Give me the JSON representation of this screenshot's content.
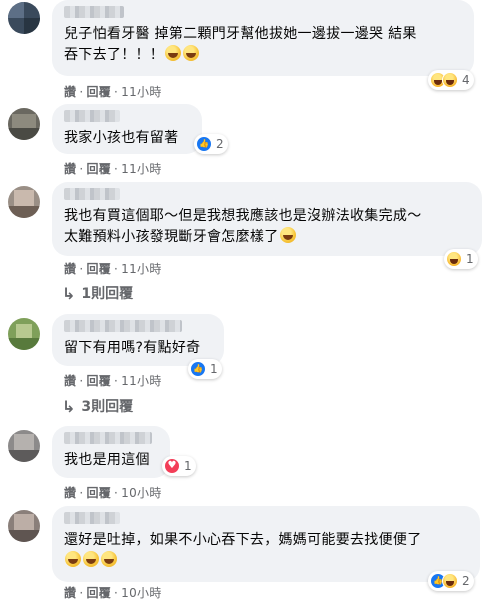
{
  "comments": [
    {
      "text": "兒子怕看牙醫 掉第二顆門牙幫他拔她一邊拔一邊哭 結果\n吞下去了！！！",
      "emoji_count": 2,
      "like_label": "讚",
      "reply_label": "回覆",
      "time": "11小時",
      "reactions": {
        "icons": [
          "haha-icon",
          "haha-icon"
        ],
        "count": "4"
      }
    },
    {
      "text": "我家小孩也有留著",
      "like_label": "讚",
      "reply_label": "回覆",
      "time": "11小時",
      "reactions": {
        "icons": [
          "like-icon"
        ],
        "count": "2"
      }
    },
    {
      "text": "我也有買這個耶～但是我想我應該也是沒辦法收集完成～\n太難預料小孩發現斷牙會怎麼樣了",
      "emoji_count": 1,
      "like_label": "讚",
      "reply_label": "回覆",
      "time": "11小時",
      "reactions": {
        "icons": [
          "haha-icon"
        ],
        "count": "1"
      },
      "replies_label": "1則回覆"
    },
    {
      "text": "留下有用嗎?有點好奇",
      "like_label": "讚",
      "reply_label": "回覆",
      "time": "11小時",
      "reactions": {
        "icons": [
          "like-icon"
        ],
        "count": "1"
      },
      "replies_label": "3則回覆"
    },
    {
      "text": "我也是用這個",
      "like_label": "讚",
      "reply_label": "回覆",
      "time": "10小時",
      "reactions": {
        "icons": [
          "love-icon"
        ],
        "count": "1"
      }
    },
    {
      "text": "還好是吐掉，如果不小心吞下去，媽媽可能要去找便便了",
      "emoji_count": 3,
      "like_label": "讚",
      "reply_label": "回覆",
      "time": "10小時",
      "reactions": {
        "icons": [
          "like-icon",
          "haha-icon"
        ],
        "count": "2"
      }
    }
  ],
  "colors": {
    "bubble": "#f0f2f5",
    "meta": "#65676b",
    "like": "#1877f2",
    "love": "#f33e58"
  }
}
